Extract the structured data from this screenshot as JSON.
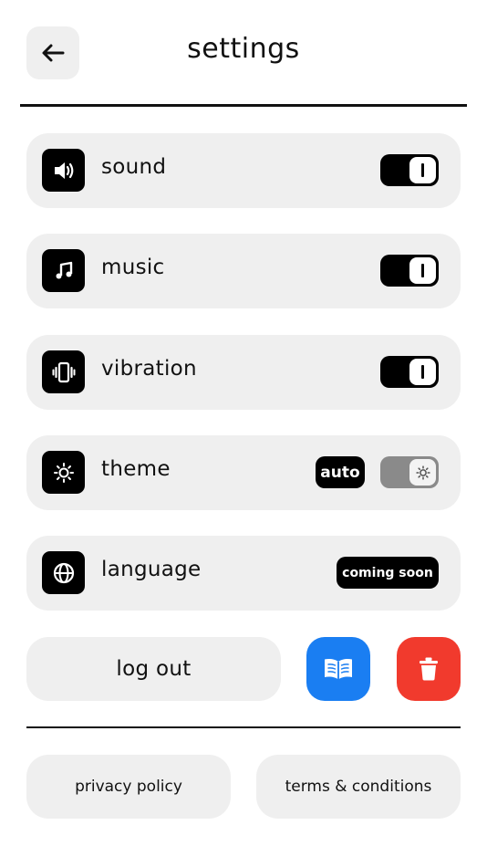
{
  "header": {
    "title": "settings",
    "back_icon": "arrow-left-icon"
  },
  "settings": [
    {
      "label": "sound",
      "icon": "speaker-icon",
      "control": "toggle",
      "enabled": true
    },
    {
      "label": "music",
      "icon": "music-note-icon",
      "control": "toggle",
      "enabled": true
    },
    {
      "label": "vibration",
      "icon": "vibration-icon",
      "control": "toggle",
      "enabled": true
    },
    {
      "label": "theme",
      "icon": "sun-icon",
      "control": "toggle",
      "badge": "auto",
      "enabled": false
    },
    {
      "label": "language",
      "icon": "globe-icon",
      "control": "badge",
      "badge": "coming soon"
    }
  ],
  "actions": {
    "logout_label": "log out",
    "book_icon": "book-icon",
    "trash_icon": "trash-icon"
  },
  "links": {
    "privacy_label": "privacy policy",
    "terms_label": "terms & conditions"
  },
  "colors": {
    "book_button": "#1a7ef2",
    "trash_button": "#f13a2d",
    "row_background": "#efefef"
  }
}
